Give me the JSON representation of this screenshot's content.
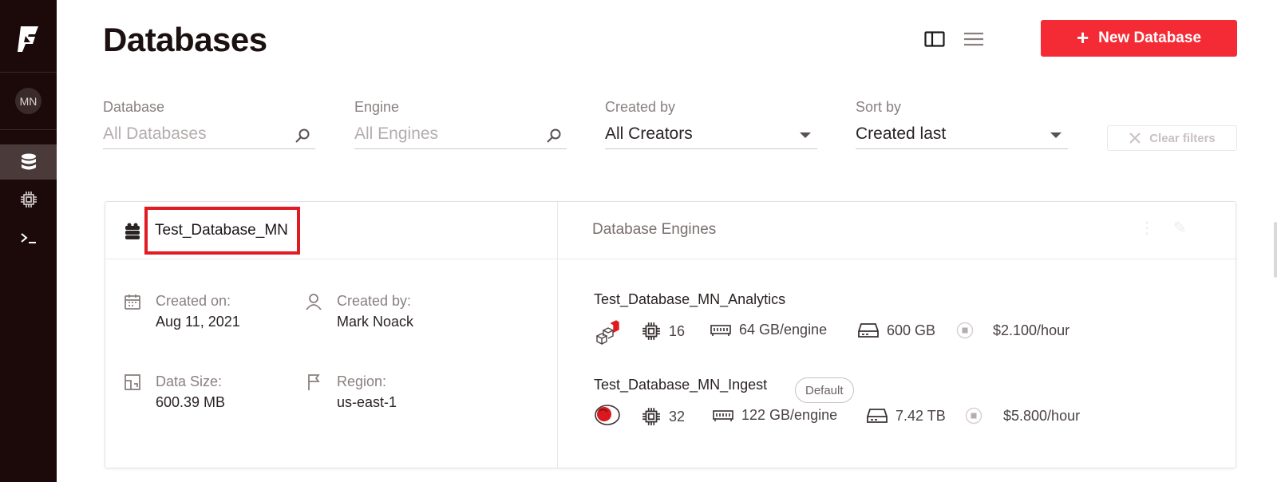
{
  "sidebar": {
    "avatar_initials": "MN",
    "items": [
      {
        "name": "databases",
        "icon": "database-icon",
        "active": true
      },
      {
        "name": "engines",
        "icon": "chip-icon",
        "active": false
      },
      {
        "name": "sql",
        "icon": "terminal-icon",
        "active": false
      }
    ]
  },
  "header": {
    "title": "Databases",
    "new_button_label": "New Database"
  },
  "filters": {
    "database": {
      "label": "Database",
      "placeholder": "All Databases"
    },
    "engine": {
      "label": "Engine",
      "placeholder": "All Engines"
    },
    "created_by": {
      "label": "Created by",
      "value": "All Creators"
    },
    "sort_by": {
      "label": "Sort by",
      "value": "Created last"
    },
    "clear_label": "Clear filters"
  },
  "database_card": {
    "name": "Test_Database_MN",
    "engines_title": "Database Engines",
    "created_on": {
      "label": "Created on:",
      "value": "Aug 11, 2021"
    },
    "created_by": {
      "label": "Created by:",
      "value": "Mark Noack"
    },
    "data_size": {
      "label": "Data Size:",
      "value": "600.39 MB"
    },
    "region": {
      "label": "Region:",
      "value": "us-east-1"
    },
    "engines": [
      {
        "name": "Test_Database_MN_Analytics",
        "cores": "16",
        "memory": "64 GB/engine",
        "storage": "600 GB",
        "cost": "$2.100/hour"
      },
      {
        "name": "Test_Database_MN_Ingest",
        "badge": "Default",
        "cores": "32",
        "memory": "122 GB/engine",
        "storage": "7.42 TB",
        "cost": "$5.800/hour"
      }
    ]
  },
  "colors": {
    "brand_red": "#f42b35",
    "highlight_red": "#e01b22",
    "sidebar_bg": "#1c0a0a"
  }
}
